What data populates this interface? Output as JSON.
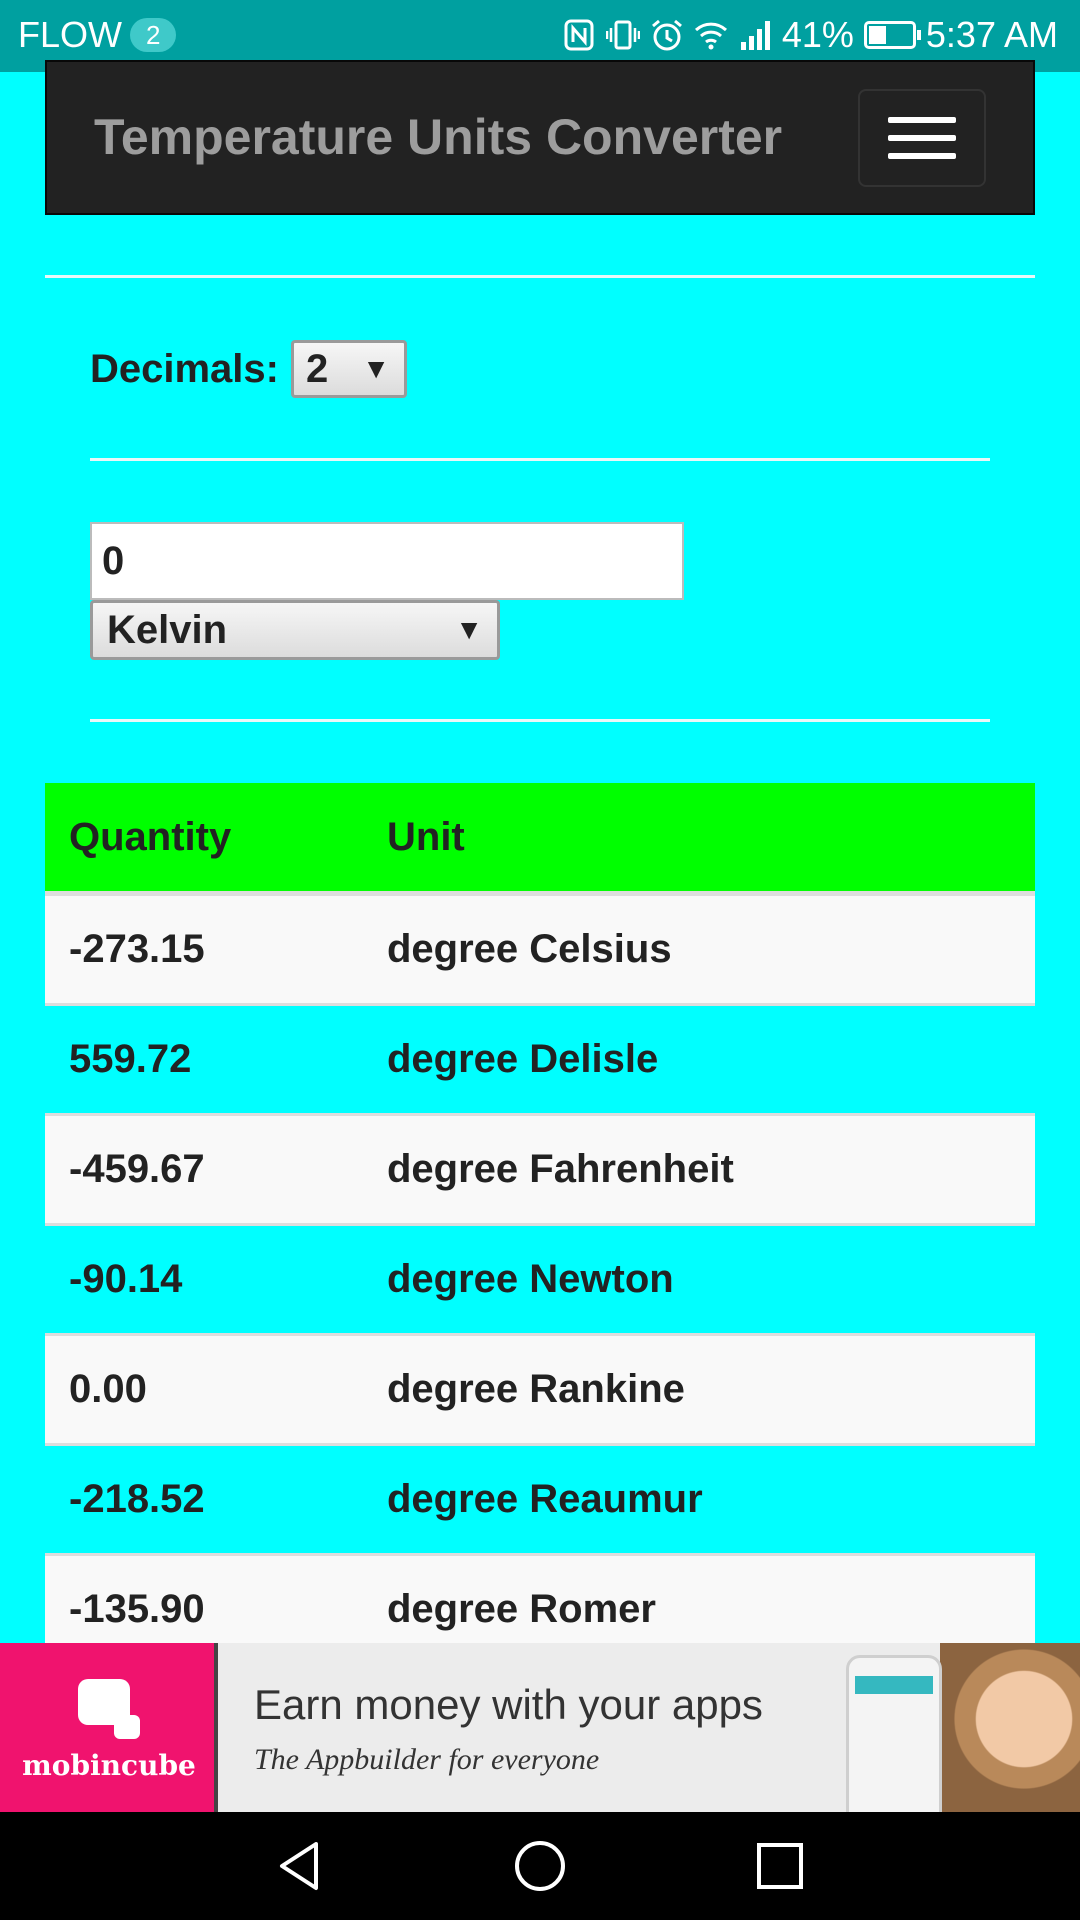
{
  "status_bar": {
    "carrier": "FLOW",
    "notification_count": "2",
    "battery": "41%",
    "battery_level": 0.41,
    "time": "5:37 AM",
    "icons": [
      "nfc-icon",
      "vibrate-icon",
      "alarm-icon",
      "wifi-icon",
      "signal-icon",
      "battery-icon"
    ]
  },
  "navbar": {
    "brand": "Temperature Units Converter",
    "menu_icon": "hamburger-menu-icon"
  },
  "decimals": {
    "label": "Decimals:",
    "selected": "2"
  },
  "input": {
    "value": "0"
  },
  "unit_select": {
    "selected": "Kelvin"
  },
  "table": {
    "headers": [
      "Quantity",
      "Unit"
    ],
    "rows": [
      {
        "quantity": "-273.15",
        "unit": "degree Celsius"
      },
      {
        "quantity": "559.72",
        "unit": "degree Delisle"
      },
      {
        "quantity": "-459.67",
        "unit": "degree Fahrenheit"
      },
      {
        "quantity": "-90.14",
        "unit": "degree Newton"
      },
      {
        "quantity": "0.00",
        "unit": "degree Rankine"
      },
      {
        "quantity": "-218.52",
        "unit": "degree Reaumur"
      },
      {
        "quantity": "-135.90",
        "unit": "degree Romer"
      }
    ]
  },
  "ad": {
    "brand": "mobincube",
    "headline": "Earn money with your apps",
    "tagline": "The Appbuilder for everyone"
  },
  "colors": {
    "page_background": "#00ffff",
    "status_bar": "#00a0a0",
    "navbar": "#222222",
    "table_header": "#00ff00",
    "ad_brand": "#f0136e"
  },
  "nav_buttons": [
    "back-icon",
    "home-icon",
    "recents-icon"
  ]
}
